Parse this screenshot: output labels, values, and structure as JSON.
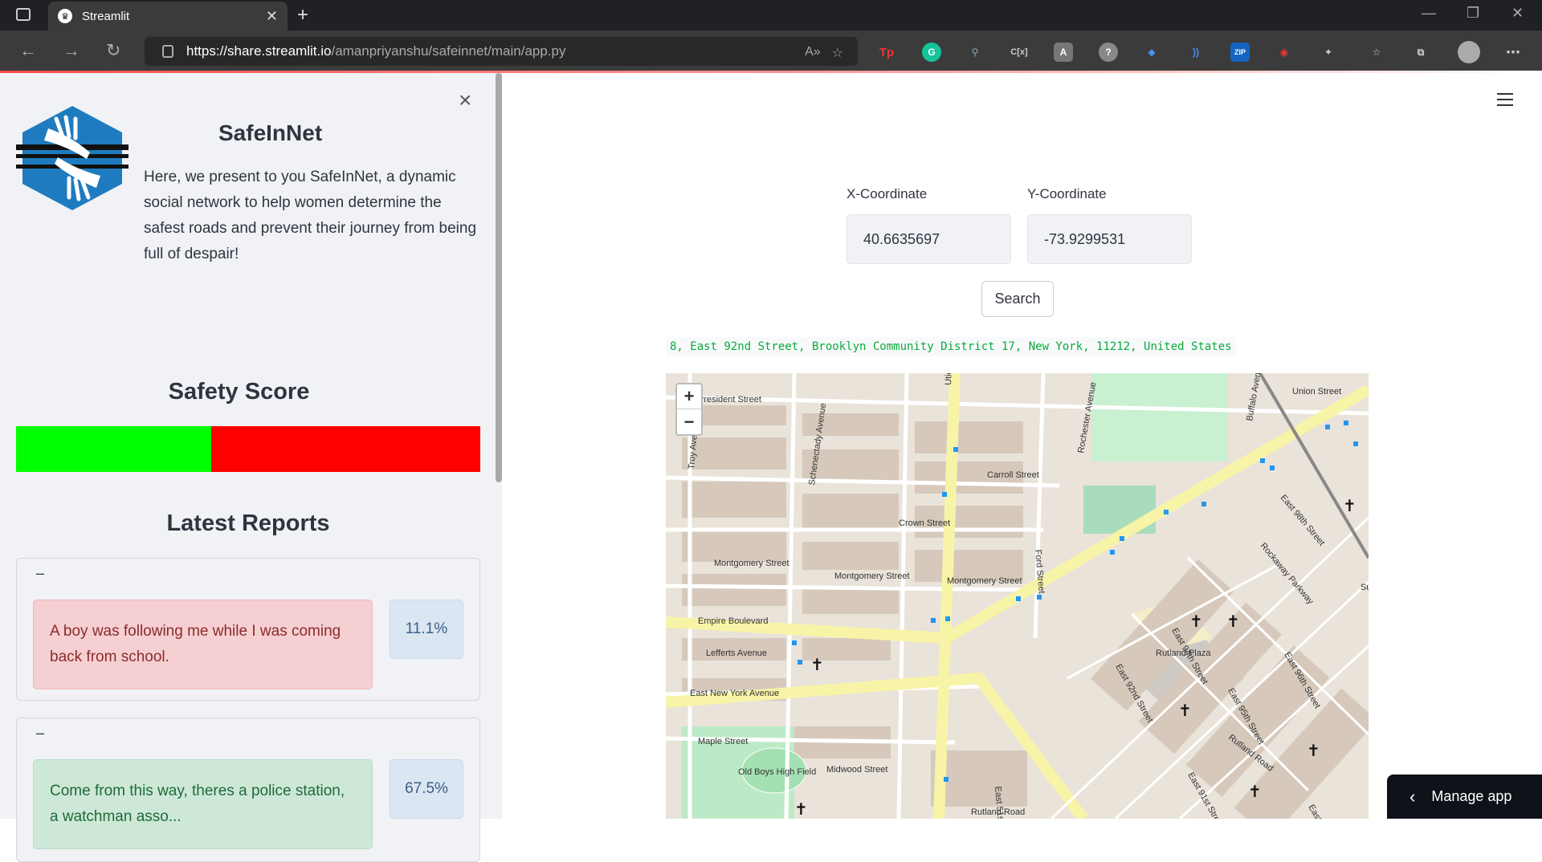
{
  "browser": {
    "tab_title": "Streamlit",
    "tab_favicon": "crown-icon",
    "url_host": "https://share.streamlit.io",
    "url_path": "/amanpriyanshu/safeinnet/main/app.py"
  },
  "sidebar": {
    "close_label": "×",
    "app_title": "SafeInNet",
    "app_description": "Here, we present to you SafeInNet, a dynamic social network to help women determine the safest roads and prevent their journey from being full of despair!",
    "safety_score_heading": "Safety Score",
    "safety_score_fraction": 0.42,
    "latest_reports_heading": "Latest Reports",
    "reports": [
      {
        "toggle": "–",
        "text": "A boy was following me while I was coming back from school.",
        "score": "11.1%",
        "tone": "red"
      },
      {
        "toggle": "–",
        "text": "Come from this way, theres a police station, a watchman asso...",
        "score": "67.5%",
        "tone": "green"
      }
    ]
  },
  "main": {
    "x_label": "X-Coordinate",
    "x_value": "40.6635697",
    "y_label": "Y-Coordinate",
    "y_value": "-73.9299531",
    "search_label": "Search",
    "address": "8, East 92nd Street, Brooklyn Community District 17, New York, 11212, United States",
    "map": {
      "zoom_in": "+",
      "zoom_out": "−",
      "street_labels": [
        "President Street",
        "Union Street",
        "Carroll Street",
        "Crown Street",
        "Montgomery Street",
        "Montgomery Street",
        "Montgomery Street",
        "Empire Boulevard",
        "Lefferts Avenue",
        "East New York Avenue",
        "Maple Street",
        "Midwood Street",
        "Rutland Road",
        "Rutland Road",
        "Utica Avenue",
        "Schenectady Avenue",
        "Troy Avenue",
        "Rochester Avenue",
        "Buffalo Avenue",
        "Ford Street",
        "Rockaway Parkway",
        "East 91st Street",
        "East 92nd Street",
        "East 93rd Street",
        "East 94th Street",
        "East 95th Street",
        "East 96th Street",
        "East 98th Street",
        "East 51st Street",
        "Rutland Plaza",
        "Old Boys High Field",
        "Sutter Avenue Rutland Road"
      ]
    },
    "manage_label": "Manage app"
  },
  "colors": {
    "safe": "#00ff00",
    "unsafe": "#ff0000",
    "address_text": "#09ab3b"
  }
}
